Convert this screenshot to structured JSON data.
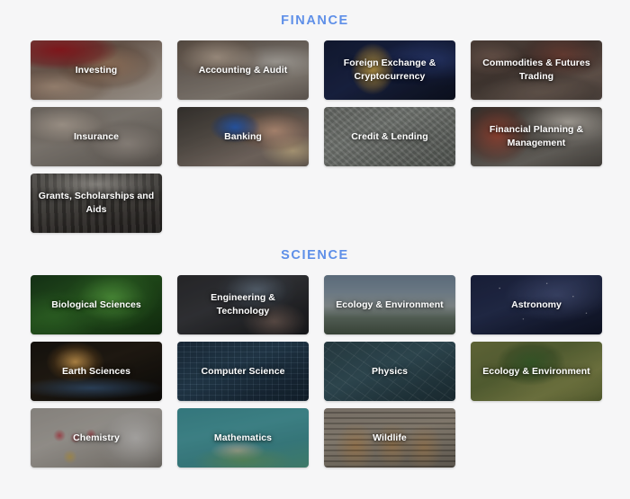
{
  "page": {
    "background_color": "#f6f6f7",
    "heading_color": "#5e8fe8",
    "label_color": "#ffffff"
  },
  "sections": [
    {
      "id": "finance",
      "heading": "FINANCE",
      "cards": [
        {
          "label": "Investing",
          "theme": "bg-investing",
          "tone": "light-photo"
        },
        {
          "label": "Accounting & Audit",
          "theme": "bg-accounting",
          "tone": "light-photo"
        },
        {
          "label": "Foreign Exchange & Cryptocurrency",
          "theme": "bg-forex",
          "tone": "dark-photo"
        },
        {
          "label": "Commodities & Futures Trading",
          "theme": "bg-commodities",
          "tone": "dark-photo"
        },
        {
          "label": "Insurance",
          "theme": "bg-insurance",
          "tone": "light-photo"
        },
        {
          "label": "Banking",
          "theme": "bg-banking",
          "tone": "dark-photo"
        },
        {
          "label": "Credit & Lending",
          "theme": "bg-credit",
          "tone": "light-photo"
        },
        {
          "label": "Financial Planning & Management",
          "theme": "bg-planning",
          "tone": "dark-photo"
        },
        {
          "label": "Grants, Scholarships and Aids",
          "theme": "bg-grants",
          "tone": "dark-photo"
        }
      ]
    },
    {
      "id": "science",
      "heading": "SCIENCE",
      "cards": [
        {
          "label": "Biological Sciences",
          "theme": "bg-biological",
          "tone": "dark-photo"
        },
        {
          "label": "Engineering & Technology",
          "theme": "bg-engineering",
          "tone": "dark-photo"
        },
        {
          "label": "Ecology & Environment",
          "theme": "bg-ecology1",
          "tone": "light-photo"
        },
        {
          "label": "Astronomy",
          "theme": "bg-astronomy",
          "tone": "dark-photo"
        },
        {
          "label": "Earth Sciences",
          "theme": "bg-earth",
          "tone": "dark-photo"
        },
        {
          "label": "Computer Science",
          "theme": "bg-computer",
          "tone": "dark-photo"
        },
        {
          "label": "Physics",
          "theme": "bg-physics",
          "tone": "dark-photo"
        },
        {
          "label": "Ecology & Environment",
          "theme": "bg-ecology2",
          "tone": "dark-photo"
        },
        {
          "label": "Chemistry",
          "theme": "bg-chemistry",
          "tone": "light-photo"
        },
        {
          "label": "Mathematics",
          "theme": "bg-mathematics",
          "tone": "dark-photo"
        },
        {
          "label": "Wildlife",
          "theme": "bg-wildlife",
          "tone": "light-photo"
        }
      ]
    }
  ]
}
